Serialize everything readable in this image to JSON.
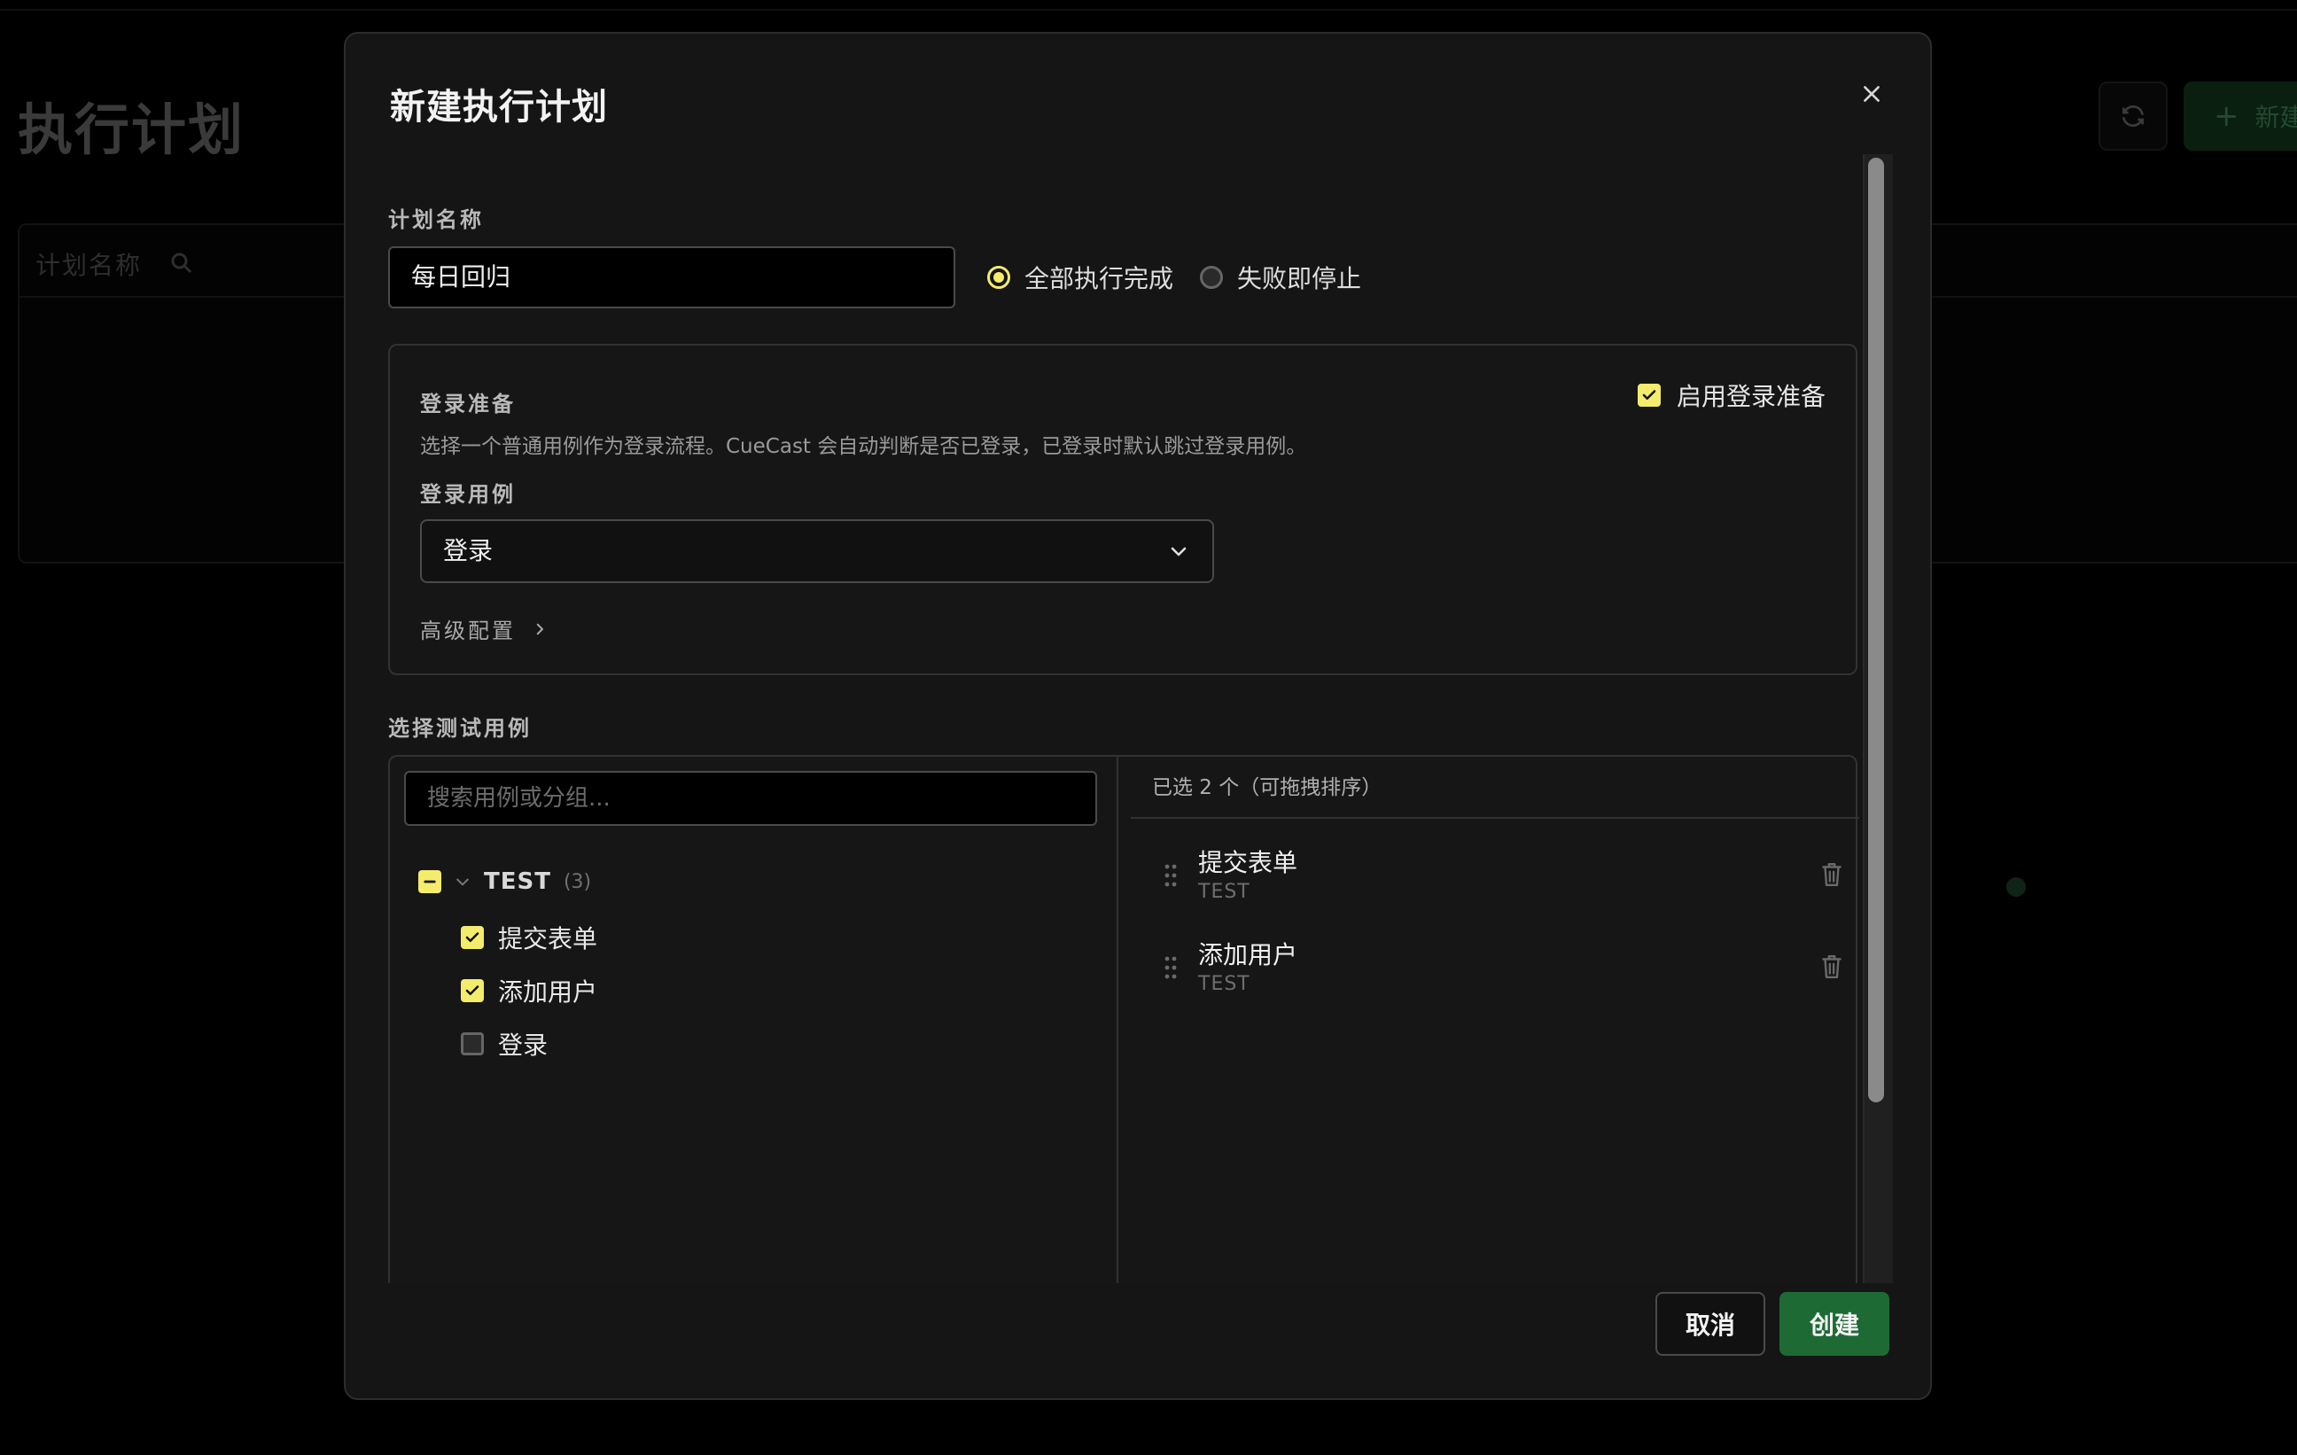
{
  "background": {
    "page_title": "执行计划",
    "search_placeholder": "计划名称",
    "new_button_label": "新建"
  },
  "modal": {
    "title": "新建执行计划",
    "plan_name": {
      "label": "计划名称",
      "value": "每日回归"
    },
    "mode_options": [
      {
        "label": "全部执行完成",
        "selected": true
      },
      {
        "label": "失败即停止",
        "selected": false
      }
    ],
    "login_prep": {
      "title": "登录准备",
      "description": "选择一个普通用例作为登录流程。CueCast 会自动判断是否已登录，已登录时默认跳过登录用例。",
      "enable_label": "启用登录准备",
      "enabled": true,
      "case_label": "登录用例",
      "case_value": "登录",
      "advanced_label": "高级配置"
    },
    "test_cases": {
      "label": "选择测试用例",
      "search_placeholder": "搜索用例或分组...",
      "group": {
        "name": "TEST",
        "count": "(3)"
      },
      "items": [
        {
          "name": "提交表单",
          "checked": true
        },
        {
          "name": "添加用户",
          "checked": true
        },
        {
          "name": "登录",
          "checked": false
        }
      ],
      "selected_header": "已选 2 个（可拖拽排序）",
      "selected": [
        {
          "name": "提交表单",
          "group": "TEST"
        },
        {
          "name": "添加用户",
          "group": "TEST"
        }
      ]
    },
    "buttons": {
      "cancel": "取消",
      "create": "创建"
    }
  },
  "colors": {
    "accent_yellow": "#f4ec6c",
    "primary_green": "#1e6a35",
    "modal_bg": "#151515"
  }
}
